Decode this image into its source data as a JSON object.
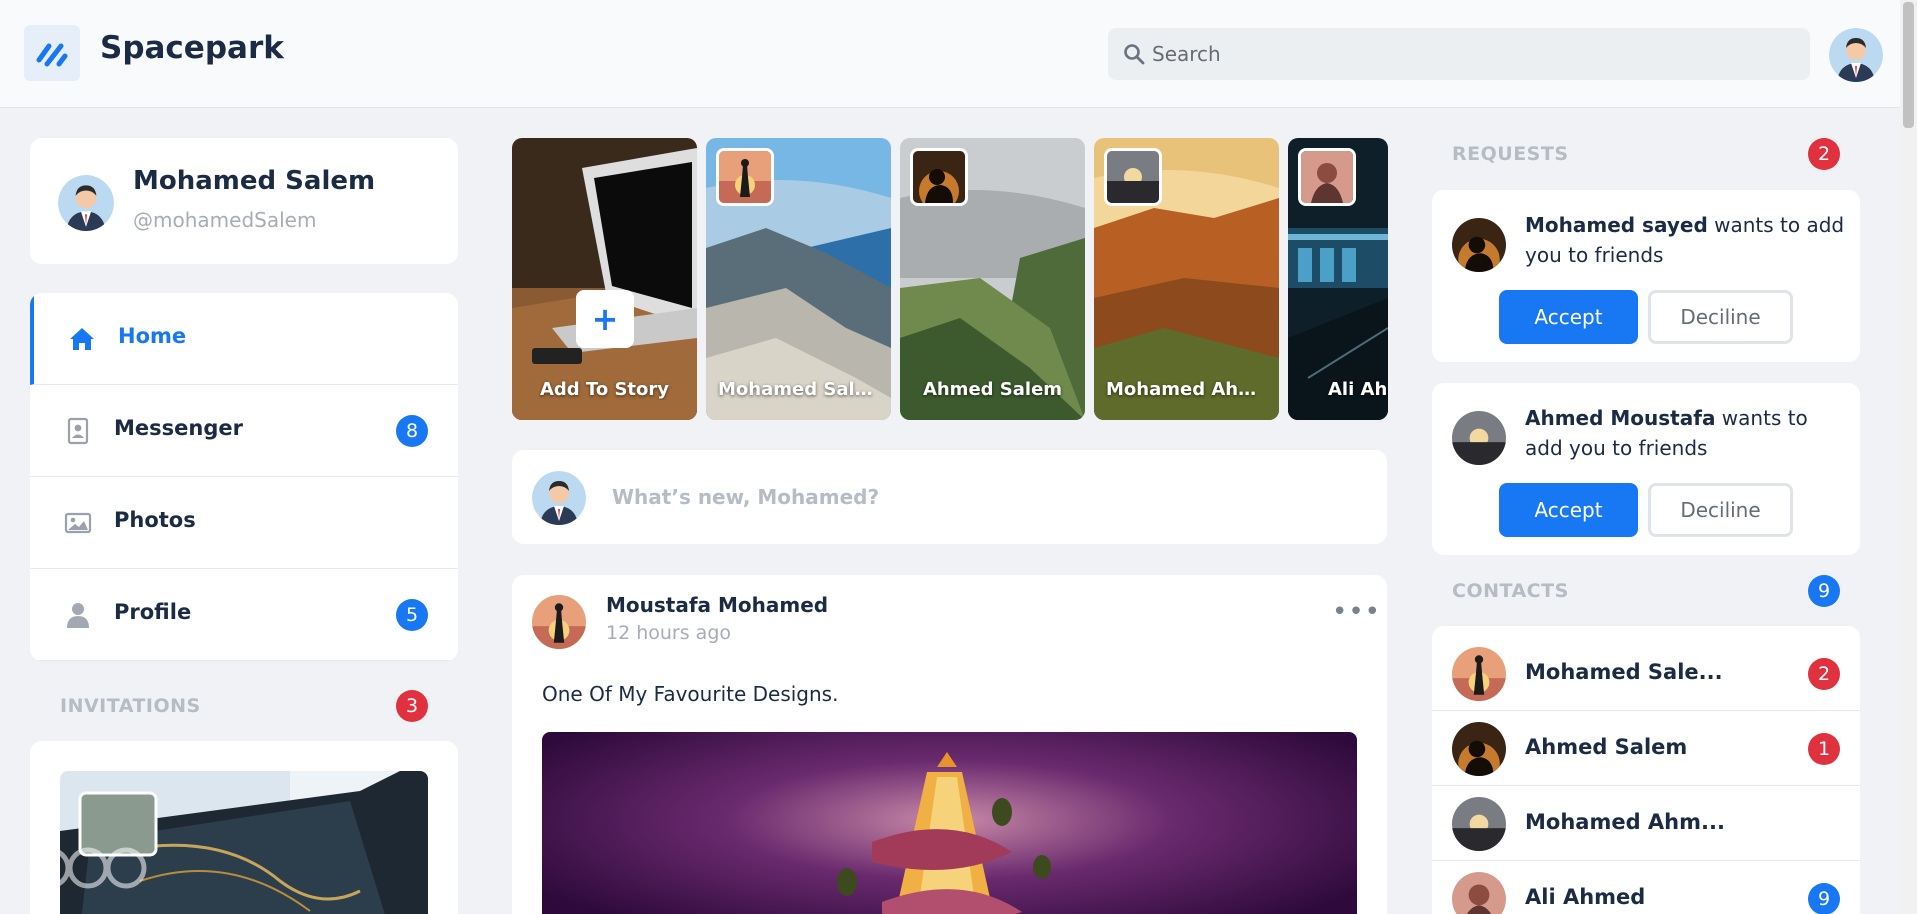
{
  "app": {
    "name": "Spacepark"
  },
  "search": {
    "placeholder": "Search"
  },
  "profile": {
    "name": "Mohamed Salem",
    "handle": "@mohamedSalem"
  },
  "nav": {
    "items": [
      {
        "label": "Home",
        "icon": "home-icon",
        "badge": ""
      },
      {
        "label": "Messenger",
        "icon": "contact-book-icon",
        "badge": "8"
      },
      {
        "label": "Photos",
        "icon": "image-icon",
        "badge": ""
      },
      {
        "label": "Profile",
        "icon": "user-icon",
        "badge": "5"
      }
    ]
  },
  "invitations": {
    "title": "INVITATIONS",
    "count": "3"
  },
  "stories": [
    {
      "label": "Add To Story"
    },
    {
      "label": "Mohamed Salem"
    },
    {
      "label": "Ahmed Salem"
    },
    {
      "label": "Mohamed Ahmed"
    },
    {
      "label": "Ali Ahmed"
    }
  ],
  "composer": {
    "placeholder": "What’s new, Mohamed?"
  },
  "post": {
    "author": "Moustafa Mohamed",
    "time": "12 hours ago",
    "text": "One Of My Favourite Designs."
  },
  "requests": {
    "title": "REQUESTS",
    "count": "2",
    "items": [
      {
        "name": "Mohamed sayed",
        "message": " wants to add you to friends",
        "accept": "Accept",
        "decline": "Deciline"
      },
      {
        "name": "Ahmed Moustafa",
        "message": " wants to add you to friends",
        "accept": "Accept",
        "decline": "Deciline"
      }
    ]
  },
  "contacts": {
    "title": "CONTACTS",
    "count": "9",
    "items": [
      {
        "name": "Mohamed Sale...",
        "badge": "2"
      },
      {
        "name": "Ahmed Salem",
        "badge": "1"
      },
      {
        "name": "Mohamed Ahm...",
        "badge": ""
      },
      {
        "name": "Ali Ahmed",
        "badge": "9"
      }
    ]
  },
  "colors": {
    "accent": "#1877f2",
    "danger": "#e0313f",
    "text": "#1c2b44",
    "muted": "#b6bcc4"
  }
}
